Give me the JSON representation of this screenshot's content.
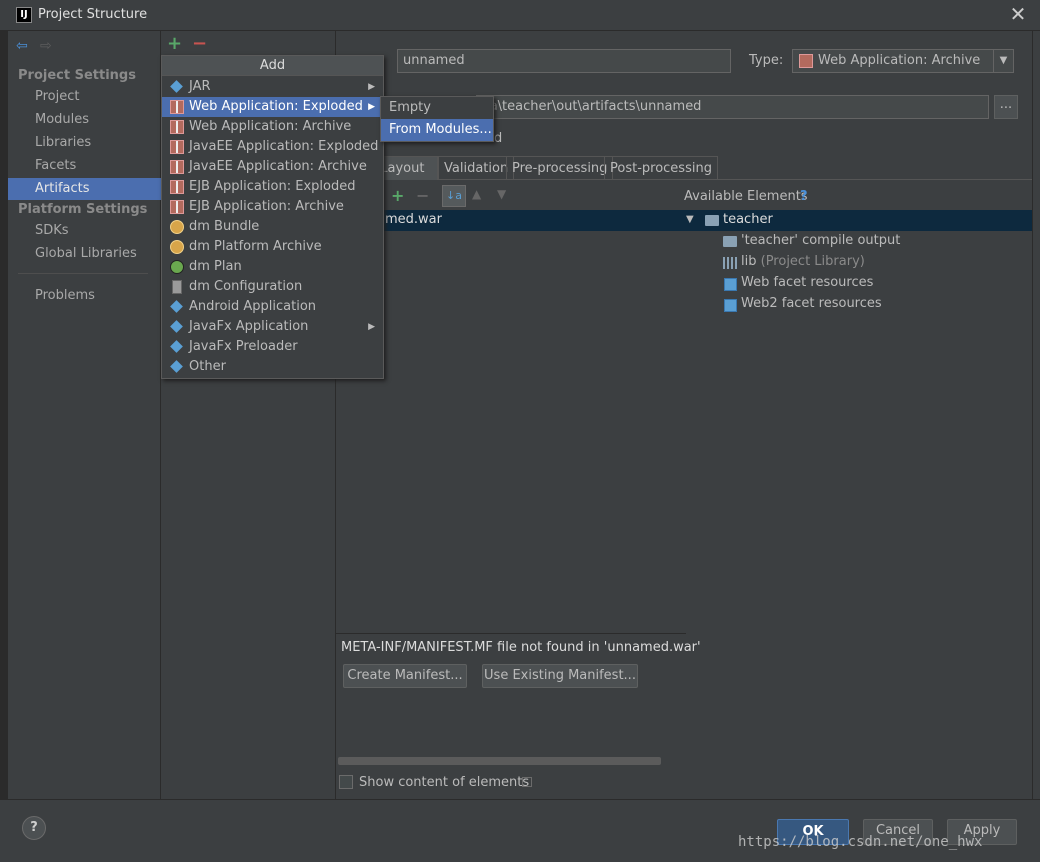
{
  "window": {
    "title": "Project Structure",
    "close_label": "✕"
  },
  "nav": {
    "back": "⇦",
    "forward": "⇨"
  },
  "sidebar": {
    "project_settings_header": "Project Settings",
    "platform_settings_header": "Platform Settings",
    "items": [
      {
        "label": "Project"
      },
      {
        "label": "Modules"
      },
      {
        "label": "Libraries"
      },
      {
        "label": "Facets"
      },
      {
        "label": "Artifacts",
        "selected": true
      },
      {
        "label": "SDKs"
      },
      {
        "label": "Global Libraries"
      },
      {
        "label": "Problems"
      }
    ]
  },
  "artifact_toolbar": {
    "add": "+",
    "remove": "−"
  },
  "add_menu": {
    "header": "Add",
    "items": [
      {
        "label": "JAR",
        "icon": "diamond-icon",
        "submenu": true
      },
      {
        "label": "Web Application: Exploded",
        "icon": "web-archive-icon",
        "submenu": true,
        "highlighted": true
      },
      {
        "label": "Web Application: Archive",
        "icon": "web-archive-icon"
      },
      {
        "label": "JavaEE Application: Exploded",
        "icon": "web-archive-icon"
      },
      {
        "label": "JavaEE Application: Archive",
        "icon": "web-archive-icon"
      },
      {
        "label": "EJB Application: Exploded",
        "icon": "web-archive-icon"
      },
      {
        "label": "EJB Application: Archive",
        "icon": "web-archive-icon"
      },
      {
        "label": "dm Bundle",
        "icon": "bundle-icon"
      },
      {
        "label": "dm Platform Archive",
        "icon": "bundle-icon"
      },
      {
        "label": "dm Plan",
        "icon": "plan-icon"
      },
      {
        "label": "dm Configuration",
        "icon": "config-icon"
      },
      {
        "label": "Android Application",
        "icon": "diamond-icon"
      },
      {
        "label": "JavaFx Application",
        "icon": "diamond-icon",
        "submenu": true
      },
      {
        "label": "JavaFx Preloader",
        "icon": "diamond-icon"
      },
      {
        "label": "Other",
        "icon": "diamond-icon"
      }
    ]
  },
  "submenu": {
    "items": [
      {
        "label": "Empty"
      },
      {
        "label": "From Modules...",
        "highlighted": true
      }
    ]
  },
  "details": {
    "name_value": "unnamed",
    "type_label": "Type:",
    "type_value": "Web Application: Archive",
    "output_dir_value": "va\\teacher\\out\\artifacts\\unnamed",
    "browse_label": "...",
    "partial_label": "d"
  },
  "tabs": [
    {
      "label": "t Layout",
      "active": true
    },
    {
      "label": "Validation"
    },
    {
      "label": "Pre-processing"
    },
    {
      "label": "Post-processing"
    }
  ],
  "layout_tree": {
    "root": "med.war"
  },
  "available": {
    "title": "Available Elements",
    "help": "?",
    "root": "teacher",
    "children": [
      {
        "label": "'teacher' compile output",
        "icon": "folder-icon"
      },
      {
        "label": "lib",
        "suffix": "(Project Library)",
        "icon": "library-icon"
      },
      {
        "label": "Web facet resources",
        "icon": "web-facet-icon"
      },
      {
        "label": "Web2 facet resources",
        "icon": "web-facet-icon"
      }
    ]
  },
  "manifest": {
    "message": "META-INF/MANIFEST.MF file not found in 'unnamed.war'",
    "create_button": "Create Manifest...",
    "use_existing_button": "Use Existing Manifest..."
  },
  "show_content_label": "Show content of elements",
  "footer": {
    "help": "?",
    "ok": "OK",
    "cancel": "Cancel",
    "apply": "Apply"
  },
  "watermark": "https://blog.csdn.net/one_hwx"
}
